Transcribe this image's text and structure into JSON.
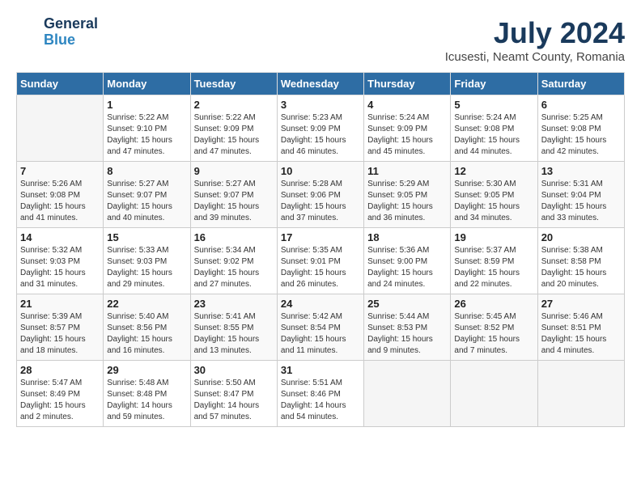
{
  "logo": {
    "line1": "General",
    "line2": "Blue"
  },
  "title": "July 2024",
  "location": "Icusesti, Neamt County, Romania",
  "headers": [
    "Sunday",
    "Monday",
    "Tuesday",
    "Wednesday",
    "Thursday",
    "Friday",
    "Saturday"
  ],
  "weeks": [
    [
      {
        "day": "",
        "info": ""
      },
      {
        "day": "1",
        "info": "Sunrise: 5:22 AM\nSunset: 9:10 PM\nDaylight: 15 hours\nand 47 minutes."
      },
      {
        "day": "2",
        "info": "Sunrise: 5:22 AM\nSunset: 9:09 PM\nDaylight: 15 hours\nand 47 minutes."
      },
      {
        "day": "3",
        "info": "Sunrise: 5:23 AM\nSunset: 9:09 PM\nDaylight: 15 hours\nand 46 minutes."
      },
      {
        "day": "4",
        "info": "Sunrise: 5:24 AM\nSunset: 9:09 PM\nDaylight: 15 hours\nand 45 minutes."
      },
      {
        "day": "5",
        "info": "Sunrise: 5:24 AM\nSunset: 9:08 PM\nDaylight: 15 hours\nand 44 minutes."
      },
      {
        "day": "6",
        "info": "Sunrise: 5:25 AM\nSunset: 9:08 PM\nDaylight: 15 hours\nand 42 minutes."
      }
    ],
    [
      {
        "day": "7",
        "info": "Sunrise: 5:26 AM\nSunset: 9:08 PM\nDaylight: 15 hours\nand 41 minutes."
      },
      {
        "day": "8",
        "info": "Sunrise: 5:27 AM\nSunset: 9:07 PM\nDaylight: 15 hours\nand 40 minutes."
      },
      {
        "day": "9",
        "info": "Sunrise: 5:27 AM\nSunset: 9:07 PM\nDaylight: 15 hours\nand 39 minutes."
      },
      {
        "day": "10",
        "info": "Sunrise: 5:28 AM\nSunset: 9:06 PM\nDaylight: 15 hours\nand 37 minutes."
      },
      {
        "day": "11",
        "info": "Sunrise: 5:29 AM\nSunset: 9:05 PM\nDaylight: 15 hours\nand 36 minutes."
      },
      {
        "day": "12",
        "info": "Sunrise: 5:30 AM\nSunset: 9:05 PM\nDaylight: 15 hours\nand 34 minutes."
      },
      {
        "day": "13",
        "info": "Sunrise: 5:31 AM\nSunset: 9:04 PM\nDaylight: 15 hours\nand 33 minutes."
      }
    ],
    [
      {
        "day": "14",
        "info": "Sunrise: 5:32 AM\nSunset: 9:03 PM\nDaylight: 15 hours\nand 31 minutes."
      },
      {
        "day": "15",
        "info": "Sunrise: 5:33 AM\nSunset: 9:03 PM\nDaylight: 15 hours\nand 29 minutes."
      },
      {
        "day": "16",
        "info": "Sunrise: 5:34 AM\nSunset: 9:02 PM\nDaylight: 15 hours\nand 27 minutes."
      },
      {
        "day": "17",
        "info": "Sunrise: 5:35 AM\nSunset: 9:01 PM\nDaylight: 15 hours\nand 26 minutes."
      },
      {
        "day": "18",
        "info": "Sunrise: 5:36 AM\nSunset: 9:00 PM\nDaylight: 15 hours\nand 24 minutes."
      },
      {
        "day": "19",
        "info": "Sunrise: 5:37 AM\nSunset: 8:59 PM\nDaylight: 15 hours\nand 22 minutes."
      },
      {
        "day": "20",
        "info": "Sunrise: 5:38 AM\nSunset: 8:58 PM\nDaylight: 15 hours\nand 20 minutes."
      }
    ],
    [
      {
        "day": "21",
        "info": "Sunrise: 5:39 AM\nSunset: 8:57 PM\nDaylight: 15 hours\nand 18 minutes."
      },
      {
        "day": "22",
        "info": "Sunrise: 5:40 AM\nSunset: 8:56 PM\nDaylight: 15 hours\nand 16 minutes."
      },
      {
        "day": "23",
        "info": "Sunrise: 5:41 AM\nSunset: 8:55 PM\nDaylight: 15 hours\nand 13 minutes."
      },
      {
        "day": "24",
        "info": "Sunrise: 5:42 AM\nSunset: 8:54 PM\nDaylight: 15 hours\nand 11 minutes."
      },
      {
        "day": "25",
        "info": "Sunrise: 5:44 AM\nSunset: 8:53 PM\nDaylight: 15 hours\nand 9 minutes."
      },
      {
        "day": "26",
        "info": "Sunrise: 5:45 AM\nSunset: 8:52 PM\nDaylight: 15 hours\nand 7 minutes."
      },
      {
        "day": "27",
        "info": "Sunrise: 5:46 AM\nSunset: 8:51 PM\nDaylight: 15 hours\nand 4 minutes."
      }
    ],
    [
      {
        "day": "28",
        "info": "Sunrise: 5:47 AM\nSunset: 8:49 PM\nDaylight: 15 hours\nand 2 minutes."
      },
      {
        "day": "29",
        "info": "Sunrise: 5:48 AM\nSunset: 8:48 PM\nDaylight: 14 hours\nand 59 minutes."
      },
      {
        "day": "30",
        "info": "Sunrise: 5:50 AM\nSunset: 8:47 PM\nDaylight: 14 hours\nand 57 minutes."
      },
      {
        "day": "31",
        "info": "Sunrise: 5:51 AM\nSunset: 8:46 PM\nDaylight: 14 hours\nand 54 minutes."
      },
      {
        "day": "",
        "info": ""
      },
      {
        "day": "",
        "info": ""
      },
      {
        "day": "",
        "info": ""
      }
    ]
  ]
}
